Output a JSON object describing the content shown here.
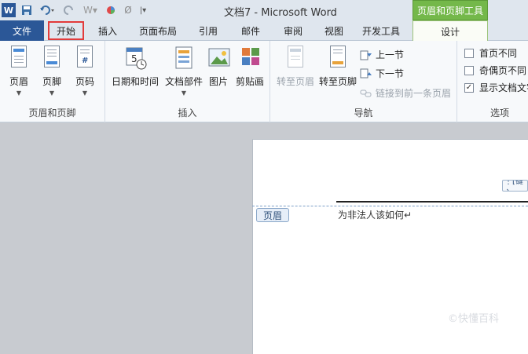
{
  "window": {
    "title": "文档7 - Microsoft Word",
    "context_tab": "页眉和页脚工具",
    "quick_access": [
      "word-logo-icon",
      "save-icon",
      "undo-icon",
      "redo-icon",
      "format-painter-icon",
      "color-icon",
      "clear-format-icon",
      "customize-qat-icon"
    ]
  },
  "tabs": [
    {
      "label": "文件"
    },
    {
      "label": "开始"
    },
    {
      "label": "插入"
    },
    {
      "label": "页面布局"
    },
    {
      "label": "引用"
    },
    {
      "label": "邮件"
    },
    {
      "label": "审阅"
    },
    {
      "label": "视图"
    },
    {
      "label": "开发工具"
    },
    {
      "label": "设计"
    }
  ],
  "ribbon": {
    "groups": {
      "header_footer": {
        "label": "页眉和页脚",
        "buttons": [
          {
            "label": "页眉"
          },
          {
            "label": "页脚"
          },
          {
            "label": "页码"
          }
        ]
      },
      "insert": {
        "label": "插入",
        "buttons": [
          {
            "label": "日期和时间"
          },
          {
            "label": "文档部件"
          },
          {
            "label": "图片"
          },
          {
            "label": "剪贴画"
          }
        ]
      },
      "navigation": {
        "label": "导航",
        "goto_header": "转至页眉",
        "goto_footer": "转至页脚",
        "prev": "上一节",
        "next": "下一节",
        "link_prev": "链接到前一条页眉"
      },
      "options": {
        "label": "选项",
        "checks": [
          {
            "label": "首页不同",
            "checked": false
          },
          {
            "label": "奇偶页不同",
            "checked": false
          },
          {
            "label": "显示文档文字",
            "checked": true
          }
        ],
        "checkmark": "✓"
      }
    }
  },
  "document": {
    "header_tag": "页眉",
    "header_text": "为非法人该如何↵",
    "field_text": "⋮[键入"
  },
  "watermark": "©快懂百科"
}
